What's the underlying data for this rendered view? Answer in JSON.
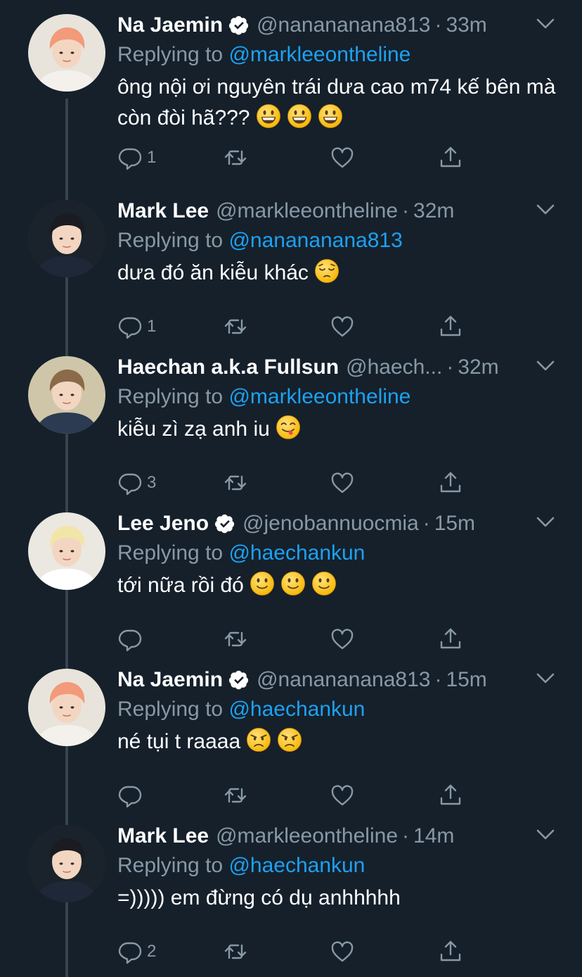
{
  "tweets": [
    {
      "name": "Na Jaemin",
      "verified": true,
      "handle": "@nanananana813",
      "separator": "·",
      "time": "33m",
      "replying_label": "Replying to",
      "replying_to": "@markleeontheline",
      "text": "ông nội ơi nguyên trái dưa cao m74 kế bên mà còn đòi hã???",
      "emojis": [
        "grinning-face",
        "grinning-face",
        "grinning-face"
      ],
      "reply_count": "1",
      "avatar_color": "#f2a07e"
    },
    {
      "name": "Mark Lee",
      "verified": false,
      "handle": "@markleeontheline",
      "separator": "·",
      "time": "32m",
      "replying_label": "Replying to",
      "replying_to": "@nanananana813",
      "text": "dưa đó ăn kiễu khác",
      "emojis": [
        "pensive-face"
      ],
      "reply_count": "1",
      "avatar_color": "#1e2530"
    },
    {
      "name": "Haechan a.k.a Fullsun",
      "verified": false,
      "handle": "@haech...",
      "separator": "·",
      "time": "32m",
      "replying_label": "Replying to",
      "replying_to": "@markleeontheline",
      "text": "kiễu zì zạ anh iu",
      "emojis": [
        "face-savoring-food"
      ],
      "reply_count": "3",
      "avatar_color": "#c9c2a8"
    },
    {
      "name": "Lee Jeno",
      "verified": true,
      "handle": "@jenobannuocmia",
      "separator": "·",
      "time": "15m",
      "replying_label": "Replying to",
      "replying_to": "@haechankun",
      "text": "tới nữa rồi đó",
      "emojis": [
        "slightly-smiling-face",
        "slightly-smiling-face",
        "slightly-smiling-face"
      ],
      "reply_count": "",
      "avatar_color": "#e9e6df"
    },
    {
      "name": "Na Jaemin",
      "verified": true,
      "handle": "@nanananana813",
      "separator": "·",
      "time": "15m",
      "replying_label": "Replying to",
      "replying_to": "@haechankun",
      "text": "né tụi t raaaa",
      "emojis": [
        "angry-face",
        "angry-face"
      ],
      "reply_count": "",
      "avatar_color": "#f2a07e"
    },
    {
      "name": "Mark Lee",
      "verified": false,
      "handle": "@markleeontheline",
      "separator": "·",
      "time": "14m",
      "replying_label": "Replying to",
      "replying_to": "@haechankun",
      "text": "=))))) em đừng có dụ anhhhhh",
      "emojis": [],
      "reply_count": "2",
      "avatar_color": "#1e2530"
    }
  ],
  "colors": {
    "background": "#15202b",
    "muted": "#8899a6",
    "accent": "#1da1f2",
    "thread_line": "#38444d"
  }
}
